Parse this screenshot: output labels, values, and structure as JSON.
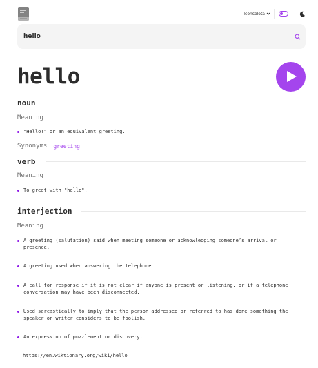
{
  "header": {
    "logo_icon": "book-icon",
    "font_selector": "Iconsolota",
    "theme_toggle": "toggle-switch",
    "theme_icon": "moon-icon"
  },
  "search": {
    "value": "hello",
    "icon": "search-icon"
  },
  "word": "hello",
  "play_icon": "play-icon",
  "colors": {
    "accent": "#a445ed",
    "text": "#2d2d2d",
    "muted": "#757575",
    "input_bg": "#f4f4f4"
  },
  "meanings": [
    {
      "part_of_speech": "noun",
      "label": "Meaning",
      "definitions": [
        "\"Hello!\" or an equivalent greeting."
      ],
      "synonyms_label": "Synonyms",
      "synonyms": [
        "greeting"
      ]
    },
    {
      "part_of_speech": "verb",
      "label": "Meaning",
      "definitions": [
        "To greet with \"hello\"."
      ]
    },
    {
      "part_of_speech": "interjection",
      "label": "Meaning",
      "definitions": [
        "A greeting (salutation) said when meeting someone or acknowledging someone’s arrival or presence.",
        "A greeting used when answering the telephone.",
        "A call for response if it is not clear if anyone is present or listening, or if a telephone conversation may have been disconnected.",
        "Used sarcastically to imply that the person addressed or referred to has done something the speaker or writer considers to be foolish.",
        "An expression of puzzlement or discovery."
      ]
    }
  ],
  "source_url": "https://en.wiktionary.org/wiki/hello"
}
